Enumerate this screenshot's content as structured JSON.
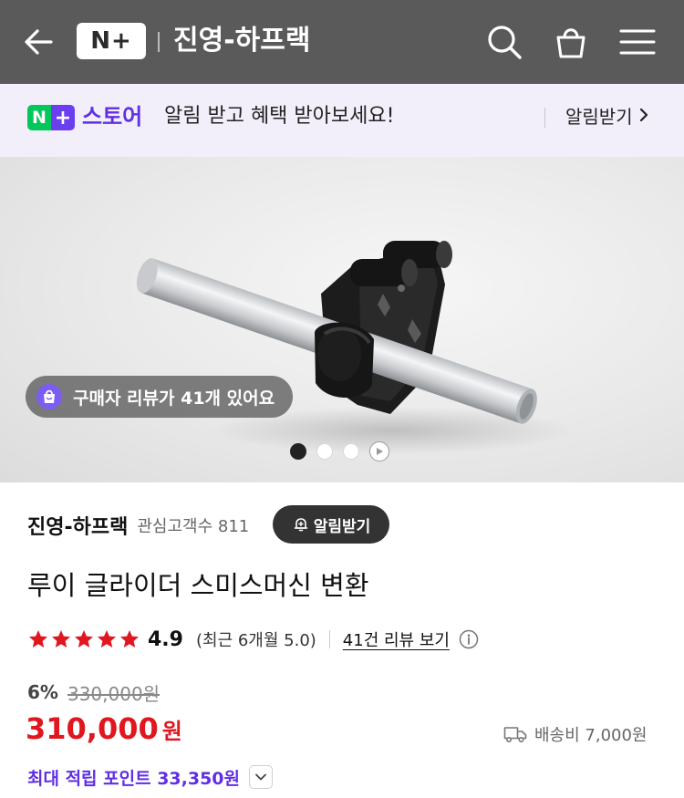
{
  "header": {
    "back_icon": "arrow-left-icon",
    "brand_badge": "N+",
    "store_name": "진영-하프랙",
    "icons": [
      "search-icon",
      "shopping-bag-icon",
      "menu-icon"
    ]
  },
  "banner": {
    "brand_badge_n": "N",
    "brand_badge_plus": "+",
    "store_word": "스토어",
    "message": "알림 받고 혜택 받아보세요!",
    "action_label": "알림받기"
  },
  "gallery": {
    "review_pill_text": "구매자 리뷰가 41개 있어요",
    "slide_count": 4,
    "active_slide": 1
  },
  "product": {
    "seller_name": "진영-하프랙",
    "fans_text": "관심고객수 811",
    "follow_label": "알림받기",
    "title": "루이 글라이더 스미스머신 변환",
    "rating": {
      "stars": 5,
      "score": "4.9",
      "recent": "(최근 6개월 5.0)",
      "reviews_link": "41건 리뷰 보기"
    },
    "discount_percent": "6%",
    "original_price": "330,000원",
    "sale_price": "310,000",
    "currency": "원",
    "shipping": "배송비 7,000원",
    "points": "최대 적립 포인트 33,350원"
  },
  "colors": {
    "header_bg": "#5a5a5a",
    "banner_bg": "#f2effa",
    "naver_green": "#03c75a",
    "accent_purple": "#5f2fe6",
    "price_red": "#e0171f",
    "star_red": "#e0171f"
  }
}
